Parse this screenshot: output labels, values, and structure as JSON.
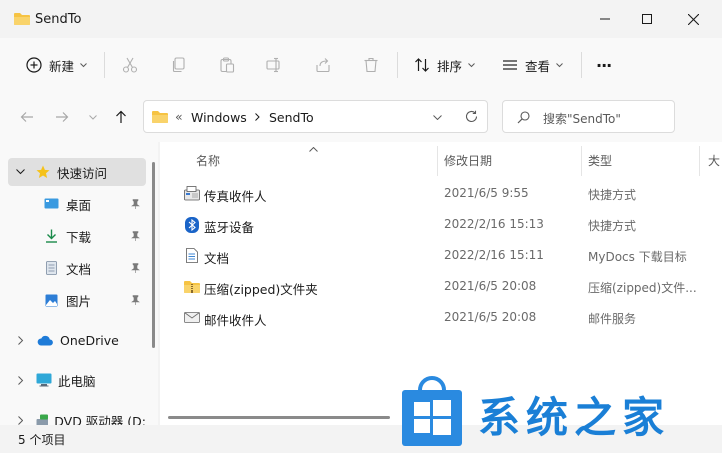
{
  "window": {
    "title": "SendTo",
    "controls": {
      "minimize": "–",
      "maximize": "□",
      "close": "✕"
    }
  },
  "toolbar": {
    "new_label": "新建",
    "sort_label": "排序",
    "view_label": "查看",
    "more_label": "···"
  },
  "address": {
    "overflow": "«",
    "crumbs": [
      "Windows",
      "SendTo"
    ],
    "search_placeholder": "搜索\"SendTo\""
  },
  "nav": {
    "quick_access": "快速访问",
    "items": [
      {
        "label": "桌面",
        "icon": "desktop-icon"
      },
      {
        "label": "下载",
        "icon": "download-icon"
      },
      {
        "label": "文档",
        "icon": "documents-icon"
      },
      {
        "label": "图片",
        "icon": "pictures-icon"
      }
    ],
    "onedrive": "OneDrive",
    "this_pc": "此电脑",
    "dvd": "DVD 驱动器 (D:"
  },
  "columns": {
    "name": "名称",
    "date": "修改日期",
    "type": "类型",
    "size": "大"
  },
  "files": [
    {
      "name": "传真收件人",
      "date": "2021/6/5 9:55",
      "type": "快捷方式",
      "icon": "fax-icon"
    },
    {
      "name": "蓝牙设备",
      "date": "2022/2/16 15:13",
      "type": "快捷方式",
      "icon": "bluetooth-icon"
    },
    {
      "name": "文档",
      "date": "2022/2/16 15:11",
      "type": "MyDocs 下载目标",
      "icon": "document-icon"
    },
    {
      "name": "压缩(zipped)文件夹",
      "date": "2021/6/5 20:08",
      "type": "压缩(zipped)文件...",
      "icon": "zip-folder-icon"
    },
    {
      "name": "邮件收件人",
      "date": "2021/6/5 20:08",
      "type": "邮件服务",
      "icon": "mail-icon"
    }
  ],
  "status": {
    "item_count": "5 个项目"
  },
  "watermark": {
    "text": "系统之家"
  },
  "colors": {
    "accent": "#0a64c8",
    "folder": "#f6c343",
    "watermark": "#1a7fd6"
  }
}
